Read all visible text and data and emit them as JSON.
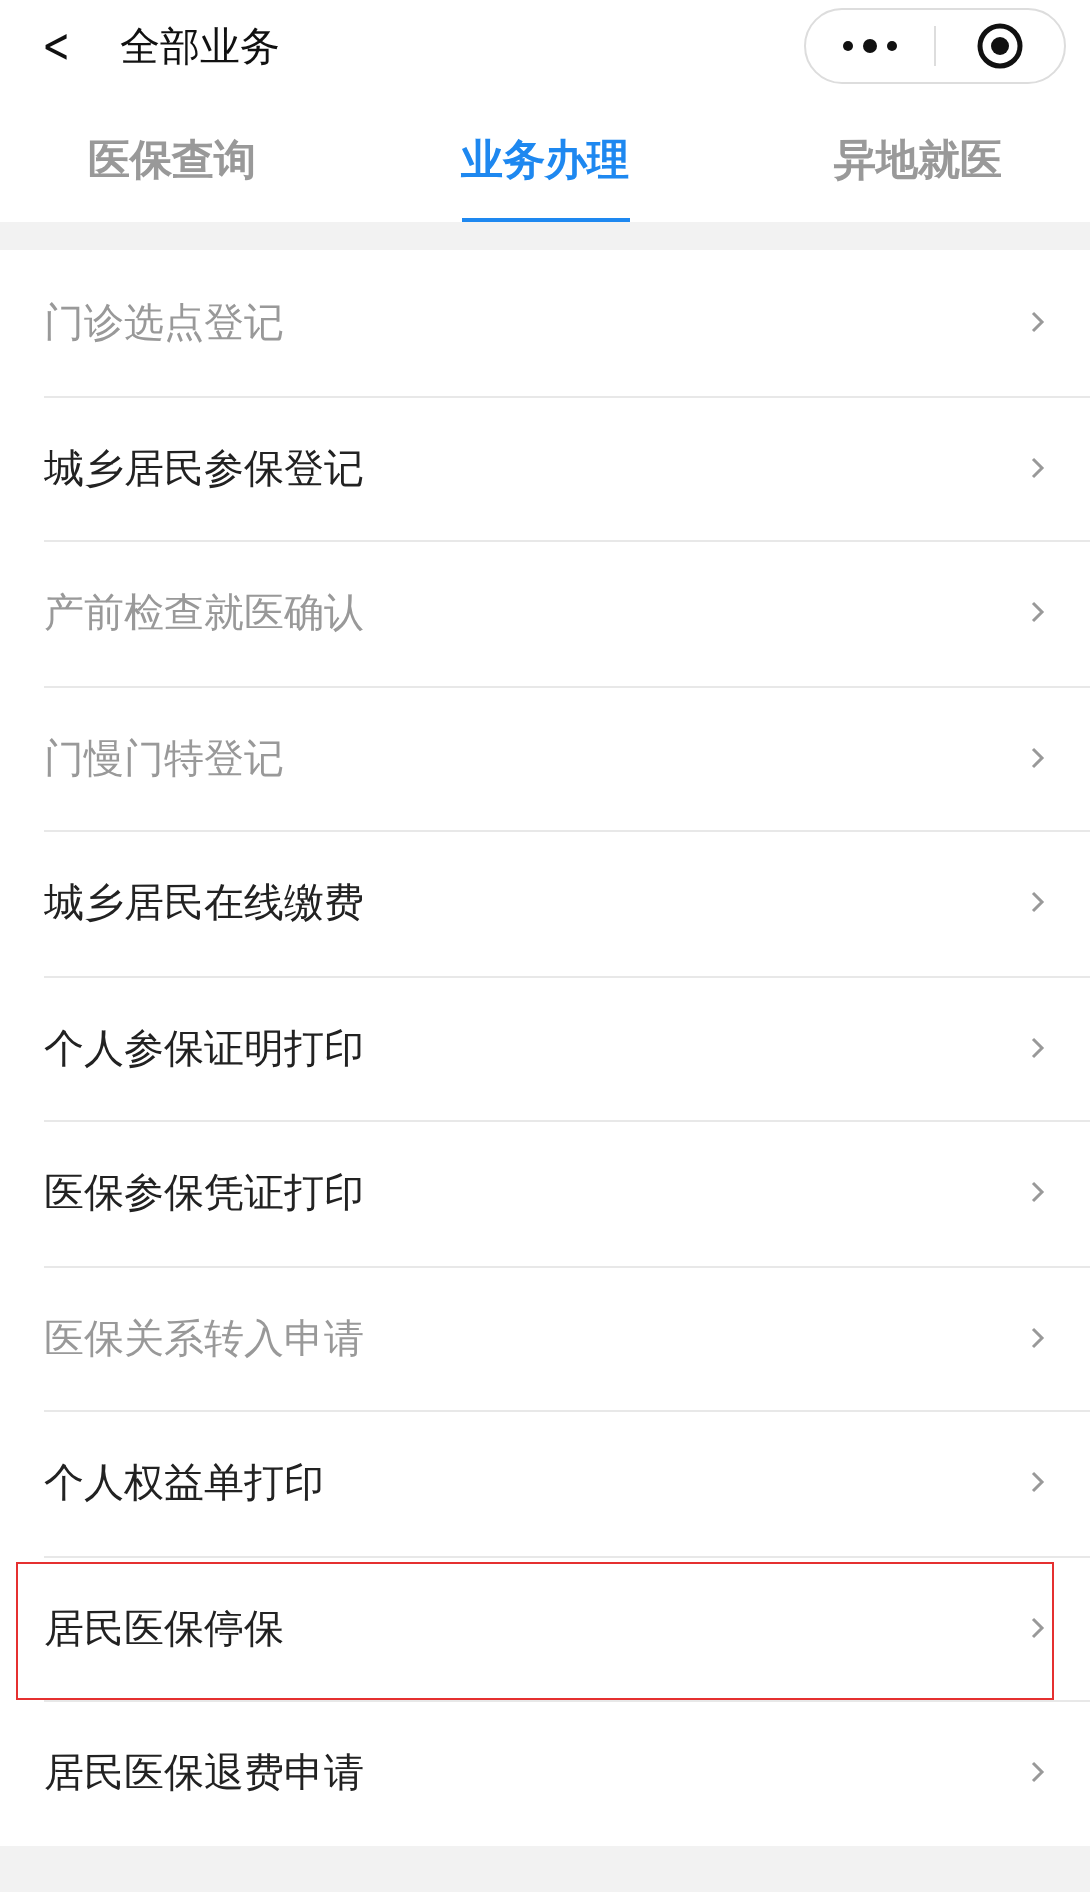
{
  "header": {
    "back_icon": "<",
    "title": "全部业务"
  },
  "tabs": [
    {
      "label": "医保查询",
      "selected": false
    },
    {
      "label": "业务办理",
      "selected": true
    },
    {
      "label": "异地就医",
      "selected": false
    }
  ],
  "items": [
    {
      "label": "门诊选点登记",
      "disabled": true,
      "highlighted": false
    },
    {
      "label": "城乡居民参保登记",
      "disabled": false,
      "highlighted": false
    },
    {
      "label": "产前检查就医确认",
      "disabled": true,
      "highlighted": false
    },
    {
      "label": "门慢门特登记",
      "disabled": true,
      "highlighted": false
    },
    {
      "label": "城乡居民在线缴费",
      "disabled": false,
      "highlighted": false
    },
    {
      "label": "个人参保证明打印",
      "disabled": false,
      "highlighted": false
    },
    {
      "label": "医保参保凭证打印",
      "disabled": false,
      "highlighted": false
    },
    {
      "label": "医保关系转入申请",
      "disabled": true,
      "highlighted": false
    },
    {
      "label": "个人权益单打印",
      "disabled": false,
      "highlighted": false
    },
    {
      "label": "居民医保停保",
      "disabled": false,
      "highlighted": true
    },
    {
      "label": "居民医保退费申请",
      "disabled": false,
      "highlighted": false
    }
  ]
}
